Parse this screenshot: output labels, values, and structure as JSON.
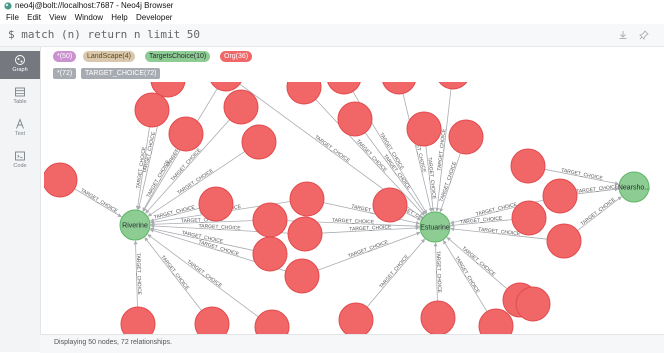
{
  "window": {
    "title": "neo4j@bolt://localhost:7687 - Neo4j Browser",
    "menu": [
      "File",
      "Edit",
      "View",
      "Window",
      "Help",
      "Developer"
    ]
  },
  "editor": {
    "query": "$ match (n) return n limit 50",
    "icons": [
      "download-icon",
      "pin-icon"
    ]
  },
  "sidebar": {
    "items": [
      {
        "label": "Graph",
        "icon": "graph-icon",
        "active": true
      },
      {
        "label": "Table",
        "icon": "table-icon",
        "active": false
      },
      {
        "label": "Text",
        "icon": "text-icon",
        "active": false
      },
      {
        "label": "Code",
        "icon": "code-icon",
        "active": false
      }
    ]
  },
  "legend": {
    "node_labels": [
      {
        "text": "*(50)",
        "bg": "#ca91cf",
        "fg": "#ffffff"
      },
      {
        "text": "LandScape(4)",
        "bg": "#d9c8ae",
        "fg": "#604a0e"
      },
      {
        "text": "TargetsChoice(10)",
        "bg": "#8dcc93",
        "fg": "#2a2c34"
      },
      {
        "text": "Org(36)",
        "bg": "#f16667",
        "fg": "#ffffff"
      }
    ],
    "rel_types": [
      {
        "text": "*(72)"
      },
      {
        "text": "TARGET_CHOICE(72)"
      }
    ]
  },
  "graph": {
    "edge_label": "TARGET_CHOICE",
    "hubs": [
      {
        "id": "riverine",
        "label": "Riverine"
      },
      {
        "id": "estuarine",
        "label": "Estuarine"
      },
      {
        "id": "nearshore",
        "label": "Nearsho..."
      }
    ],
    "colors": {
      "org": "#f16667",
      "hub": "#8dcc93"
    }
  },
  "status": {
    "text": "Displaying 50 nodes, 72 relationships."
  }
}
